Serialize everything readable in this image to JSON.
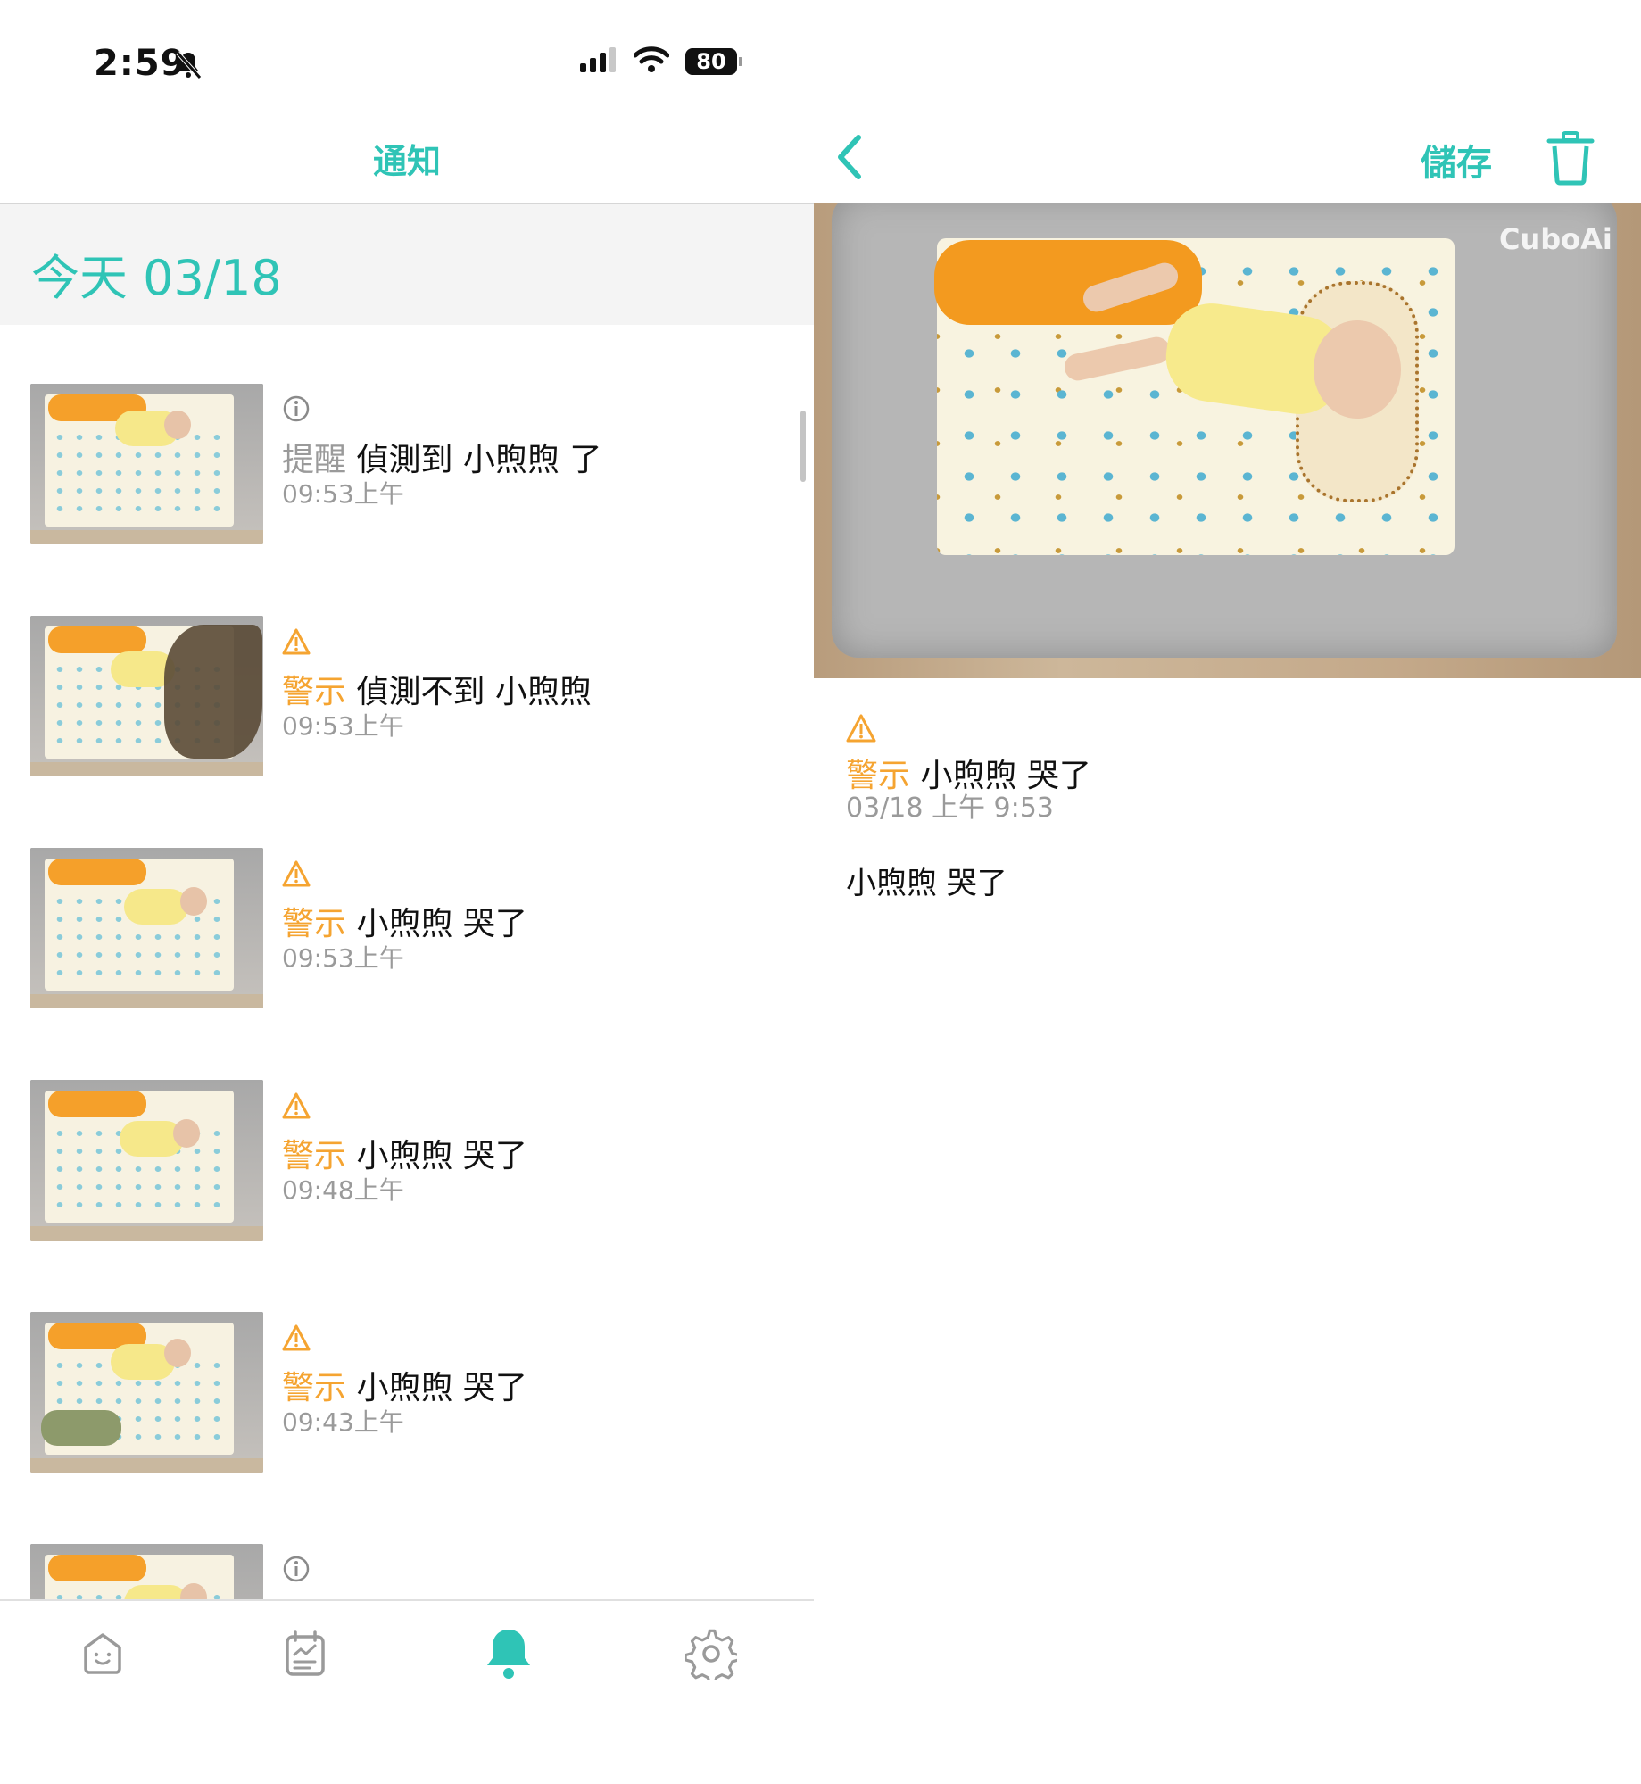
{
  "status": {
    "time": "2:59",
    "battery": "80"
  },
  "notifications_screen": {
    "title": "通知",
    "date_header": "今天 03/18",
    "items": [
      {
        "type": "info",
        "tag": "提醒",
        "text": "偵測到 小煦煦 了",
        "time": "09:53上午"
      },
      {
        "type": "warn",
        "tag": "警示",
        "text": "偵測不到 小煦煦",
        "time": "09:53上午"
      },
      {
        "type": "warn",
        "tag": "警示",
        "text": "小煦煦 哭了",
        "time": "09:53上午"
      },
      {
        "type": "warn",
        "tag": "警示",
        "text": "小煦煦 哭了",
        "time": "09:48上午"
      },
      {
        "type": "warn",
        "tag": "警示",
        "text": "小煦煦 哭了",
        "time": "09:43上午"
      },
      {
        "type": "info",
        "tag": "",
        "text": "",
        "time": ""
      }
    ]
  },
  "tabbar": {
    "items": [
      "home",
      "journal",
      "notifications",
      "settings"
    ],
    "active": "notifications"
  },
  "detail_screen": {
    "save_label": "儲存",
    "video_watermark": "CuboAi",
    "tag": "警示",
    "text": "小煦煦 哭了",
    "timestamp": "03/18 上午 9:53",
    "body": "小煦煦 哭了"
  },
  "colors": {
    "accent": "#2fc4b6",
    "warning": "#f5a431",
    "muted": "#9a9a9a"
  }
}
